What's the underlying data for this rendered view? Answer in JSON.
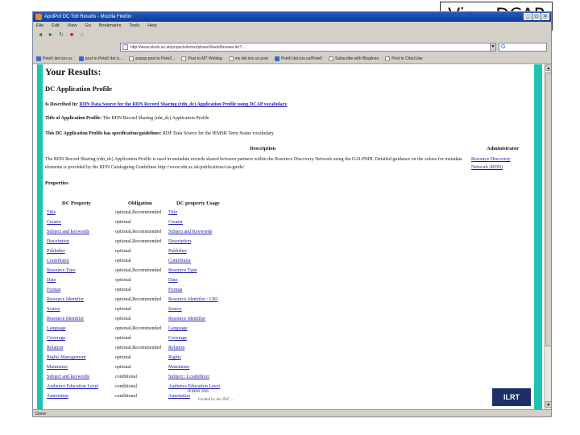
{
  "slide_label": "View DCAP",
  "window": {
    "title": "ApolPof DC Tob Results - Mozilla Firefox",
    "menu": [
      "Eile",
      "Edit",
      "View",
      "Go",
      "Bookmarks",
      "Tools",
      "Help"
    ],
    "url": "http://www.ukoln.ac.uk/projects/iemsr/phase3/web/browse.do?...",
    "search_glyph": "G"
  },
  "bookmarks": [
    {
      "icon": "bookmark",
      "label": "Pete0 del.icio.us"
    },
    {
      "icon": "bookmark",
      "label": "post to Pete0 del.ic..."
    },
    {
      "icon": "page",
      "label": "popup post to Pete2..."
    },
    {
      "icon": "page",
      "label": "Post to MT Weblog"
    },
    {
      "icon": "page",
      "label": "my del.icio.us post"
    },
    {
      "icon": "bookmark",
      "label": "Pete0 del.icio.us/Pete0"
    },
    {
      "icon": "page",
      "label": "Subscribe with Bloglines"
    },
    {
      "icon": "page",
      "label": "Post to CiteULike"
    }
  ],
  "page": {
    "heading": "Your Results:",
    "profile_title": "DC Application Profile",
    "described_in_label": "Is Described In:",
    "described_in_link": "RDN Data Source for the RDN Record Sharing (rdn_dc) Application Profile using DCAP vocabulary",
    "title_label": "Title of Application Profile:",
    "title_value": "The RDN Record Sharing (rdn_dc) Application Profile",
    "spec_label": "This DC Application Profile has specification/guidelines:",
    "spec_value": "RDF Data Source for the IEMSR Term Status vocabulary",
    "description_header": "Description",
    "administrator_header": "Administrator",
    "description_text": "The RDN Record Sharing (rdn_dc) Application Profile is used in metadata records shared between partners within the Resource Discovery Network using the OAI-PMH. Detailed guidance on the values for metadata elements is provided by the RDN Cataloguing Guidelines http://www.rdn.ac.uk/publications/cat-guide/",
    "administrator_link": "Resource Discovery Network (RDN)",
    "properties_label": "Properties",
    "columns": [
      "DC Property",
      "Obligation",
      "DC property Usage"
    ],
    "properties": [
      {
        "name": "Title",
        "obligation": "optional,Recommended",
        "usage": "Title"
      },
      {
        "name": "Creator",
        "obligation": "optional",
        "usage": "Creator"
      },
      {
        "name": "Subject and keywords",
        "obligation": "optional,Recommended",
        "usage": "Subject and Keywords"
      },
      {
        "name": "Description",
        "obligation": "optional,Recommended",
        "usage": "Description"
      },
      {
        "name": "Publisher",
        "obligation": "optional",
        "usage": "Publisher"
      },
      {
        "name": "Contributor",
        "obligation": "optional",
        "usage": "Contributor"
      },
      {
        "name": "Resource Type",
        "obligation": "optional,Recommended",
        "usage": "Resource Type"
      },
      {
        "name": "Date",
        "obligation": "optional",
        "usage": "Date"
      },
      {
        "name": "Format",
        "obligation": "optional",
        "usage": "Format"
      },
      {
        "name": "Resource Identifier",
        "obligation": "optional,Recommended",
        "usage": "Resource Identifier : URI"
      },
      {
        "name": "Source",
        "obligation": "optional",
        "usage": "Source"
      },
      {
        "name": "Resource Identifier",
        "obligation": "optional",
        "usage": "Resource Identifier"
      },
      {
        "name": "Language",
        "obligation": "optional,Recommended",
        "usage": "Language"
      },
      {
        "name": "Coverage",
        "obligation": "optional",
        "usage": "Coverage"
      },
      {
        "name": "Relation",
        "obligation": "optional,Recommended",
        "usage": "Relation"
      },
      {
        "name": "Rights Management",
        "obligation": "optional",
        "usage": "Rights"
      },
      {
        "name": "Maintainer",
        "obligation": "optional",
        "usage": "Maintainer"
      },
      {
        "name": "Subject and keywords",
        "obligation": "conditional",
        "usage": "Subject : Lcsubdirect"
      },
      {
        "name": "Audience Education Level",
        "obligation": "conditional",
        "usage": "Audience Education Level"
      },
      {
        "name": "Annotation",
        "obligation": "conditional",
        "usage": "Annotation"
      }
    ],
    "footer_line1": "IEMSR 2005",
    "footer_line2": "Funded by the JISC ...",
    "logo_text": "ILRT"
  },
  "status": "Done"
}
